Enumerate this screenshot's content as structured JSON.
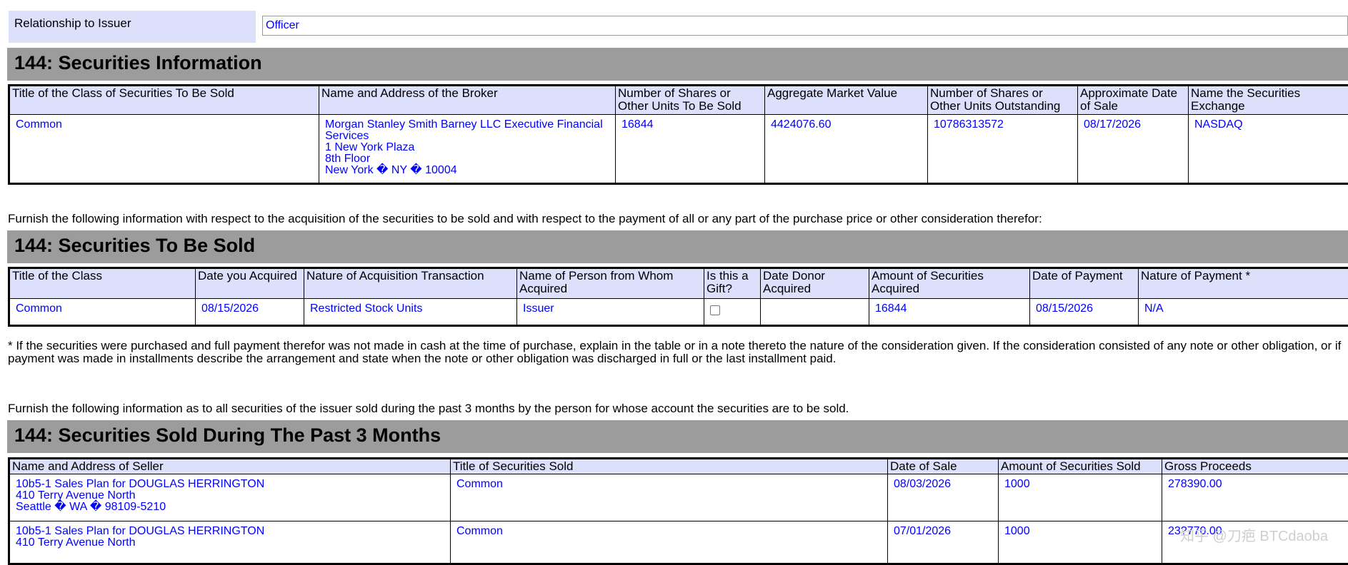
{
  "relationship": {
    "label": "Relationship to Issuer",
    "value": "Officer"
  },
  "sec_info": {
    "heading": "144: Securities Information",
    "columns": [
      "Title of the Class of Securities To Be Sold",
      "Name and Address of the Broker",
      "Number of Shares or Other Units To Be Sold",
      "Aggregate Market Value",
      "Number of Shares or Other Units Outstanding",
      "Approximate Date of Sale",
      "Name the Securities Exchange"
    ],
    "row": {
      "title": "Common",
      "broker_name": "Morgan Stanley Smith Barney LLC Executive Financial Services",
      "broker_addr1": "1 New York Plaza",
      "broker_addr2": "8th Floor",
      "broker_addr3": "New York � NY � 10004",
      "shares": "16844",
      "market_value": "4424076.60",
      "outstanding": "10786313572",
      "date": "08/17/2026",
      "exchange": "NASDAQ"
    }
  },
  "furnish1": "Furnish the following information with respect to the acquisition of the securities to be sold and with respect to the payment of all or any part of the purchase price or other consideration therefor:",
  "to_be_sold": {
    "heading": "144: Securities To Be Sold",
    "columns": [
      "Title of the Class",
      "Date you Acquired",
      "Nature of Acquisition Transaction",
      "Name of Person from Whom Acquired",
      "Is this a Gift?",
      "Date Donor Acquired",
      "Amount of Securities Acquired",
      "Date of Payment",
      "Nature of Payment *"
    ],
    "row": {
      "title": "Common",
      "date_acquired": "08/15/2026",
      "nature": "Restricted Stock Units",
      "person": "Issuer",
      "gift": false,
      "donor_date": "",
      "amount": "16844",
      "payment_date": "08/15/2026",
      "payment_nature": "N/A"
    }
  },
  "footnote": "* If the securities were purchased and full payment therefor was not made in cash at the time of purchase, explain in the table or in a note thereto the nature of the consideration given. If the consideration consisted of any note or other obligation, or if payment was made in installments describe the arrangement and state when the note or other obligation was discharged in full or the last installment paid.",
  "furnish2": "Furnish the following information as to all securities of the issuer sold during the past 3 months by the person for whose account the securities are to be sold.",
  "past3": {
    "heading": "144: Securities Sold During The Past 3 Months",
    "columns": [
      "Name and Address of Seller",
      "Title of Securities Sold",
      "Date of Sale",
      "Amount of Securities Sold",
      "Gross Proceeds"
    ],
    "rows": [
      {
        "name": "10b5-1 Sales Plan for DOUGLAS HERRINGTON",
        "addr1": "410 Terry Avenue North",
        "addr2": "Seattle � WA � 98109-5210",
        "title": "Common",
        "date": "08/03/2026",
        "amount": "1000",
        "proceeds": "278390.00"
      },
      {
        "name": "10b5-1 Sales Plan for DOUGLAS HERRINGTON",
        "addr1": "410 Terry Avenue North",
        "addr2": "",
        "title": "Common",
        "date": "07/01/2026",
        "amount": "1000",
        "proceeds": "23?770.00"
      }
    ]
  },
  "watermark": "知乎 @刀疤 BTCdaoba"
}
